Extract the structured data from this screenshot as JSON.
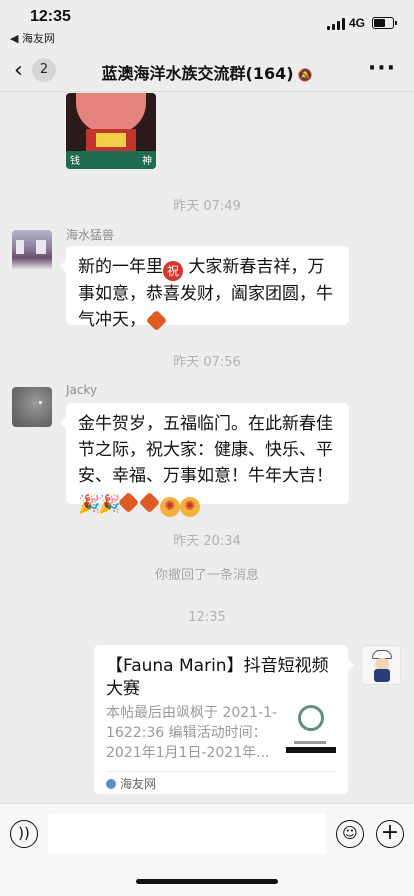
{
  "status_bar": {
    "time": "12:35",
    "back_app": "◀ 海友网",
    "network": "4G",
    "battery_level": 0.65
  },
  "nav": {
    "back_icon": "chevron-left-icon",
    "unread_count": "2",
    "title": "蓝澳海洋水族交流群(164)",
    "mute_icon": "bell-muted-icon",
    "more_icon": "more-dots-icon"
  },
  "messages": {
    "time1": "昨天 07:49",
    "sender1": "海水猛兽",
    "msg1_part1": "新的一年里",
    "msg1_part2": " 大家新春吉祥，万事如意，恭喜发财，阖家团圆，牛气冲天，",
    "emoji_blessing": "祝",
    "time2": "昨天 07:56",
    "sender2": "Jacky",
    "msg2_text": "金牛贺岁，五福临门。在此新春佳节之际，祝大家：健康、快乐、平安、幸福、万事如意！牛年大吉！",
    "time3": "昨天 20:34",
    "recall_notice": "你撤回了一条消息",
    "time4": "12:35"
  },
  "link_card": {
    "title": "【Fauna Marin】抖音短视频大赛",
    "description": "本帖最后由飒枫于 2021-1-1622:36 编辑活动时间：2021年1月1日-2021年...",
    "source": "海友网"
  },
  "input_bar": {
    "voice_icon": "voice-icon",
    "emoji_icon": "smiley-icon",
    "plus_icon": "plus-icon"
  }
}
